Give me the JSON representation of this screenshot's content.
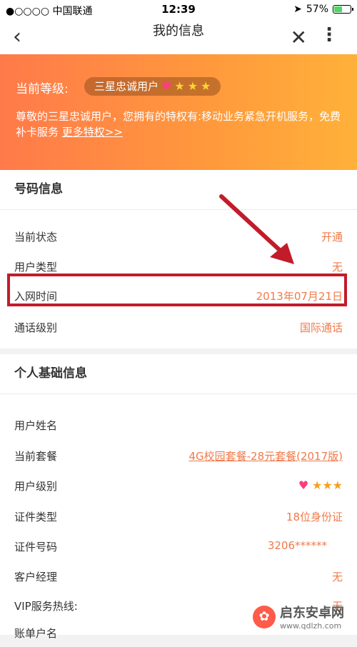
{
  "status_bar": {
    "carrier": "●○○○○ 中国联通",
    "time": "12:39",
    "battery_percent": "57%",
    "battery_level": 0.57
  },
  "nav": {
    "back_icon": "chevron-left-icon",
    "title": "我的信息",
    "close_icon": "close-icon",
    "more_icon": "more-vertical-icon"
  },
  "banner": {
    "level_label": "当前等级:",
    "level_badge": "三星忠诚用户",
    "level_stars": 3,
    "description": "尊敬的三星忠诚用户，您拥有的特权有:移动业务紧急开机服务，免费补卡服务",
    "more_link": "更多特权>>",
    "colors": {
      "start": "#ff7a4a",
      "end": "#ffb13a"
    }
  },
  "number_info": {
    "title": "号码信息",
    "rows": [
      {
        "key": "当前状态",
        "value": "开通"
      },
      {
        "key": "用户类型",
        "value": "无"
      },
      {
        "key": "入网时间",
        "value": "2013年07月21日"
      },
      {
        "key": "通话级别",
        "value": "国际通话"
      }
    ]
  },
  "personal_info": {
    "title": "个人基础信息",
    "rows": [
      {
        "key": "用户姓名",
        "value": ""
      },
      {
        "key": "当前套餐",
        "value": "4G校园套餐-28元套餐(2017版)"
      },
      {
        "key": "用户级别",
        "value": "",
        "stars": 3
      },
      {
        "key": "证件类型",
        "value": "18位身份证"
      },
      {
        "key": "证件号码",
        "value": "3206******"
      },
      {
        "key": "客户经理",
        "value": "无"
      },
      {
        "key": "VIP服务热线:",
        "value": "无"
      },
      {
        "key": "账单户名",
        "value": ""
      }
    ]
  },
  "watermark": {
    "name": "启东安卓网",
    "url": "www.qdlzh.com"
  },
  "accent_color": "#f07a4a",
  "highlight_color": "#c21c2a"
}
